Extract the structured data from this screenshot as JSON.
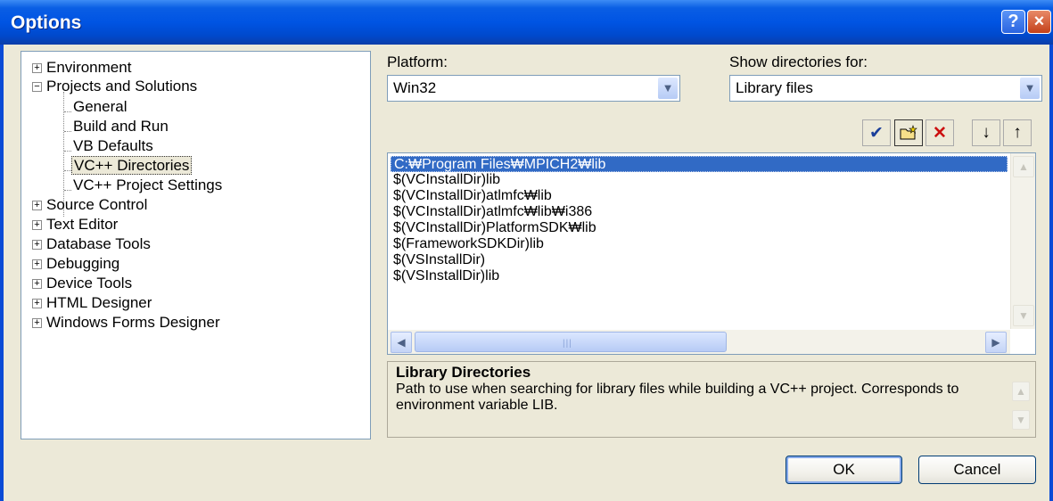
{
  "window": {
    "title": "Options",
    "help_label": "?",
    "close_label": "×"
  },
  "tree": {
    "items": [
      {
        "label": "Environment",
        "expander": "+"
      },
      {
        "label": "Projects and Solutions",
        "expander": "−"
      },
      {
        "label": "General"
      },
      {
        "label": "Build and Run"
      },
      {
        "label": "VB Defaults"
      },
      {
        "label": "VC++ Directories",
        "selected": true
      },
      {
        "label": "VC++ Project Settings"
      },
      {
        "label": "Source Control",
        "expander": "+"
      },
      {
        "label": "Text Editor",
        "expander": "+"
      },
      {
        "label": "Database Tools",
        "expander": "+"
      },
      {
        "label": "Debugging",
        "expander": "+"
      },
      {
        "label": "Device Tools",
        "expander": "+"
      },
      {
        "label": "HTML Designer",
        "expander": "+"
      },
      {
        "label": "Windows Forms Designer",
        "expander": "+"
      }
    ]
  },
  "platform": {
    "label": "Platform:",
    "value": "Win32"
  },
  "show_dirs": {
    "label": "Show directories for:",
    "value": "Library files"
  },
  "toolbar": {
    "check_icon": "✔",
    "delete_icon": "✕",
    "down_icon": "↓",
    "up_icon": "↑"
  },
  "directories": [
    "C:₩Program Files₩MPICH2₩lib",
    "$(VCInstallDir)lib",
    "$(VCInstallDir)atlmfc₩lib",
    "$(VCInstallDir)atlmfc₩lib₩i386",
    "$(VCInstallDir)PlatformSDK₩lib",
    "$(FrameworkSDKDir)lib",
    "$(VSInstallDir)",
    "$(VSInstallDir)lib"
  ],
  "description": {
    "title": "Library Directories",
    "text": "Path to use when searching for library files while building a VC++ project. Corresponds to environment variable LIB."
  },
  "buttons": {
    "ok": "OK",
    "cancel": "Cancel"
  },
  "colors": {
    "titlebar": "#0054E3",
    "selection": "#316AC5",
    "dialog": "#ECE9D8"
  }
}
